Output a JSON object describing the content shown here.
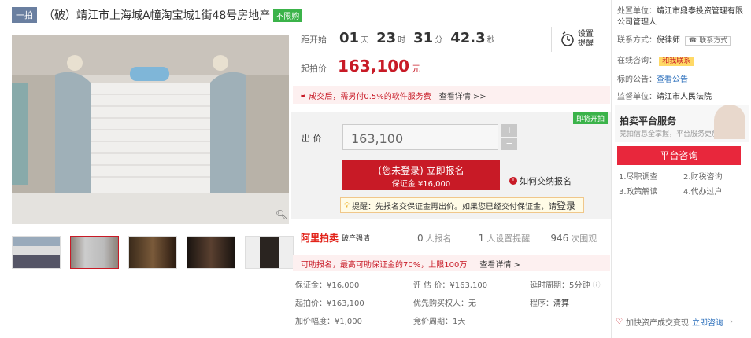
{
  "header": {
    "tag": "一拍",
    "title": "（破）靖江市上海城A幢淘宝城1街48号房地产",
    "badge": "不限购"
  },
  "countdown": {
    "label": "距开始",
    "days": "01",
    "days_unit": "天",
    "hours": "23",
    "hours_unit": "时",
    "minutes": "31",
    "minutes_unit": "分",
    "seconds": "42.3",
    "seconds_unit": "秒"
  },
  "remind": {
    "label_line1": "设置",
    "label_line2": "提醒"
  },
  "start_price": {
    "label": "起拍价",
    "value": "163,100",
    "unit": "元"
  },
  "notice": {
    "text": "成交后，需另付0.5%的软件服务费",
    "link": "查看详情 >>"
  },
  "bid": {
    "soon_tag": "即将开拍",
    "label": "出 价",
    "value": "163,100",
    "plus": "+",
    "minus": "−",
    "signup_line1": "(您未登录) 立即报名",
    "signup_line2": "保证金 ¥16,000",
    "how_to": "如何交纳报名",
    "hint_prefix": "提醒：先报名交保证金再出价。如果您已经交付保证金，请",
    "hint_link": "登录"
  },
  "stats": {
    "logo": "阿里拍卖",
    "logo_sub": "破产强清",
    "signups": "0",
    "signups_label": "人报名",
    "reminders": "1",
    "reminders_label": "人设置提醒",
    "views": "946",
    "views_label": "次围观"
  },
  "loan_bar": {
    "text": "可助报名，最高可助保证金的70%，上限100万",
    "link": "查看详情 >"
  },
  "info": {
    "deposit": "保证金：¥16,000",
    "appraisal": "评 估 价：¥163,100",
    "delay": "延时周期：5分钟",
    "start": "起拍价：¥163,100",
    "priority": "优先购买权人：无",
    "procedure_label": "程序：",
    "procedure_value": "清算",
    "increment": "加价幅度：¥1,000",
    "cycle": "竞价周期：1天"
  },
  "sidebar": {
    "disposal_label": "处置单位：",
    "disposal_value": "靖江市鼎泰投资管理有限公司管理人",
    "contact_label": "联系方式：",
    "contact_value": "倪律师",
    "contact_badge": "联系方式",
    "consult_label": "在线咨询：",
    "consult_badge": "和我联系",
    "notice_label": "标的公告：",
    "notice_link": "查看公告",
    "supervisor_label": "监督单位：",
    "supervisor_value": "靖江市人民法院",
    "service_title": "拍卖平台服务",
    "service_sub": "竞拍信息全掌握，平台服务更放心",
    "service_btn": "平台咨询",
    "services": [
      "1.尽职调查",
      "2.财税咨询",
      "3.政策解读",
      "4.代办过户"
    ],
    "bottom_text": "加快资产成交变现",
    "bottom_link": "立即咨询"
  },
  "colors": {
    "accent": "#c81a26",
    "green": "#3bb34a",
    "button": "#e8273c"
  }
}
